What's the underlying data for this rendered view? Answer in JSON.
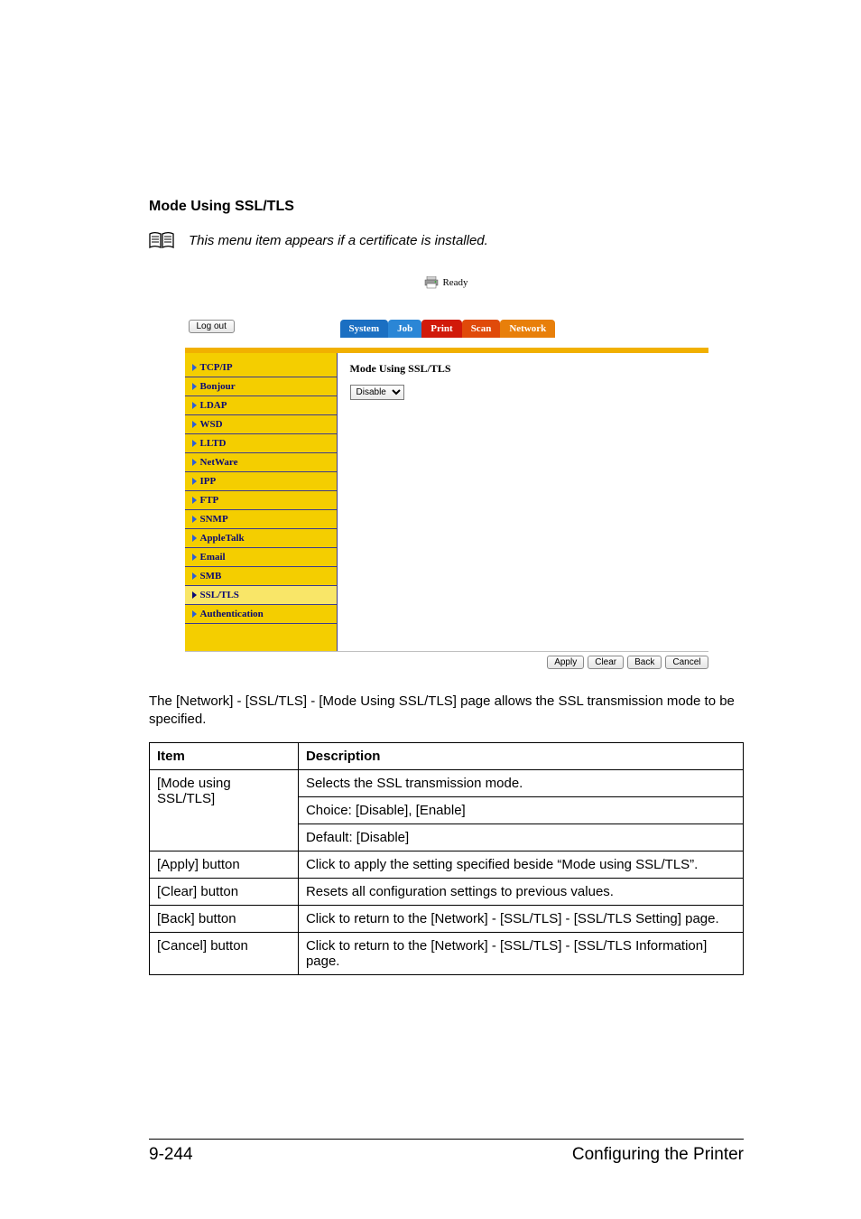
{
  "heading": "Mode Using SSL/TLS",
  "note": "This menu item appears if a certificate is installed.",
  "status_text": "Ready",
  "logout_label": "Log out",
  "tabs": [
    "System",
    "Job",
    "Print",
    "Scan",
    "Network"
  ],
  "side_items": [
    {
      "label": "TCP/IP",
      "active": false
    },
    {
      "label": "Bonjour",
      "active": false
    },
    {
      "label": "LDAP",
      "active": false
    },
    {
      "label": "WSD",
      "active": false
    },
    {
      "label": "LLTD",
      "active": false
    },
    {
      "label": "NetWare",
      "active": false
    },
    {
      "label": "IPP",
      "active": false
    },
    {
      "label": "FTP",
      "active": false
    },
    {
      "label": "SNMP",
      "active": false
    },
    {
      "label": "AppleTalk",
      "active": false
    },
    {
      "label": "Email",
      "active": false
    },
    {
      "label": "SMB",
      "active": false
    },
    {
      "label": "SSL/TLS",
      "active": true
    },
    {
      "label": "Authentication",
      "active": false
    }
  ],
  "main_panel_title": "Mode Using SSL/TLS",
  "dropdown_value": "Disable",
  "footer_buttons": [
    "Apply",
    "Clear",
    "Back",
    "Cancel"
  ],
  "body_paragraph": "The [Network] - [SSL/TLS] - [Mode Using SSL/TLS] page allows the SSL transmission mode to be specified.",
  "table": {
    "headers": [
      "Item",
      "Description"
    ],
    "rows": [
      {
        "item": "[Mode using SSL/TLS]",
        "desc": [
          "Selects the SSL transmission mode.",
          "Choice:  [Disable], [Enable]",
          "Default:  [Disable]"
        ]
      },
      {
        "item": "[Apply] button",
        "desc": [
          "Click to apply the setting specified beside “Mode using SSL/TLS”."
        ]
      },
      {
        "item": "[Clear] button",
        "desc": [
          "Resets all configuration settings to previous values."
        ]
      },
      {
        "item": "[Back] button",
        "desc": [
          "Click to return to the [Network] - [SSL/TLS] - [SSL/TLS Setting] page."
        ]
      },
      {
        "item": "[Cancel] button",
        "desc": [
          "Click to return to the [Network] - [SSL/TLS] - [SSL/TLS Information] page."
        ]
      }
    ]
  },
  "page_number": "9-244",
  "page_section": "Configuring the Printer"
}
